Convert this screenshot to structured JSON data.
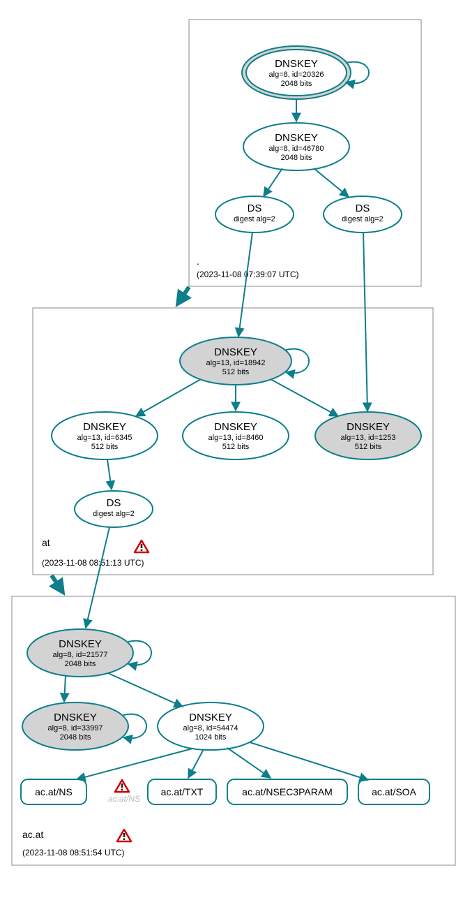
{
  "zones": {
    "root": {
      "label": ".",
      "ts": "(2023-11-08 07:39:07 UTC)"
    },
    "at": {
      "label": "at",
      "ts": "(2023-11-08 08:51:13 UTC)"
    },
    "acat": {
      "label": "ac.at",
      "ts": "(2023-11-08 08:51:54 UTC)"
    }
  },
  "nodes": {
    "root_ksk": {
      "title": "DNSKEY",
      "l2": "alg=8, id=20326",
      "l3": "2048 bits"
    },
    "root_zsk": {
      "title": "DNSKEY",
      "l2": "alg=8, id=46780",
      "l3": "2048 bits"
    },
    "root_ds1": {
      "title": "DS",
      "l2": "digest alg=2"
    },
    "root_ds2": {
      "title": "DS",
      "l2": "digest alg=2"
    },
    "at_ksk": {
      "title": "DNSKEY",
      "l2": "alg=13, id=18942",
      "l3": "512 bits"
    },
    "at_k1": {
      "title": "DNSKEY",
      "l2": "alg=13, id=6345",
      "l3": "512 bits"
    },
    "at_k2": {
      "title": "DNSKEY",
      "l2": "alg=13, id=8460",
      "l3": "512 bits"
    },
    "at_k3": {
      "title": "DNSKEY",
      "l2": "alg=13, id=1253",
      "l3": "512 bits"
    },
    "at_ds": {
      "title": "DS",
      "l2": "digest alg=2"
    },
    "ac_ksk": {
      "title": "DNSKEY",
      "l2": "alg=8, id=21577",
      "l3": "2048 bits"
    },
    "ac_k1": {
      "title": "DNSKEY",
      "l2": "alg=8, id=33997",
      "l3": "2048 bits"
    },
    "ac_k2": {
      "title": "DNSKEY",
      "l2": "alg=8, id=54474",
      "l3": "1024 bits"
    }
  },
  "rr": {
    "ns": "ac.at/NS",
    "txt": "ac.at/TXT",
    "n3p": "ac.at/NSEC3PARAM",
    "soa": "ac.at/SOA",
    "ghost": "ac.at/NS"
  }
}
